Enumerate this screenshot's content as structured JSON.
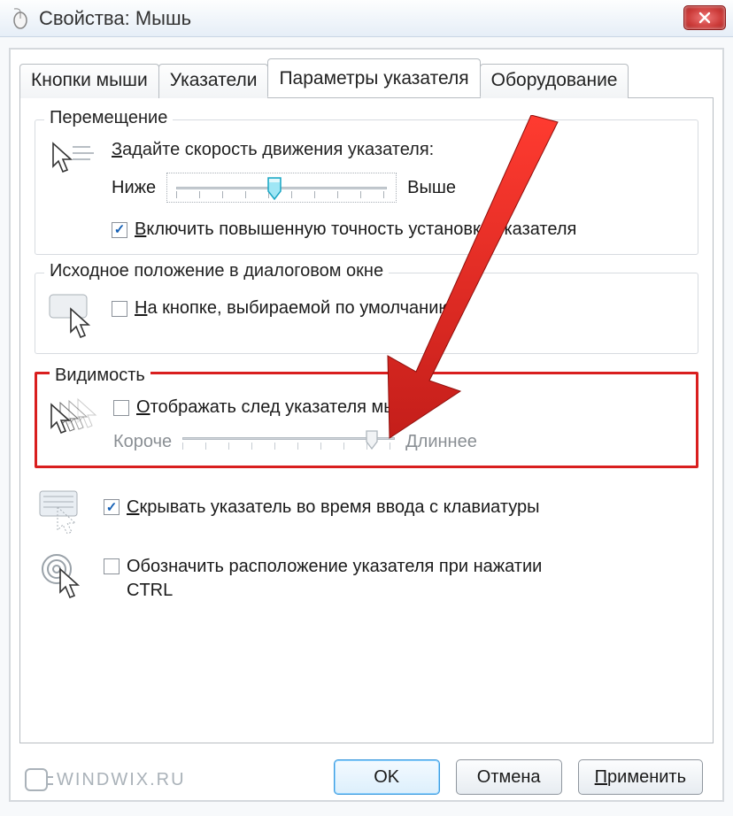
{
  "window": {
    "title": "Свойства: Мышь"
  },
  "tabs": {
    "t0": "Кнопки мыши",
    "t1": "Указатели",
    "t2": "Параметры указателя",
    "t3": "Оборудование",
    "active": 2
  },
  "motion": {
    "legend": "Перемещение",
    "prompt": "Задайте скорость движения указателя:",
    "low": "Ниже",
    "high": "Выше",
    "enhance": "Включить повышенную точность установки указателя",
    "enhance_checked": true,
    "slider_value": 5,
    "slider_max": 10
  },
  "snap": {
    "legend": "Исходное положение в диалоговом окне",
    "label": "На кнопке, выбираемой по умолчанию",
    "checked": false
  },
  "visibility": {
    "legend": "Видимость",
    "trails_label": "Отображать след указателя мыши",
    "trails_checked": false,
    "short": "Короче",
    "long": "Длиннее",
    "trails_value": 9,
    "trails_max": 10,
    "hide_label": "Скрывать указатель во время ввода с клавиатуры",
    "hide_checked": true,
    "ctrl_label": "Обозначить расположение указателя при нажатии CTRL",
    "ctrl_checked": false
  },
  "buttons": {
    "ok": "OK",
    "cancel": "Отмена",
    "apply": "Применить"
  },
  "watermark": "WINDWIX.RU"
}
